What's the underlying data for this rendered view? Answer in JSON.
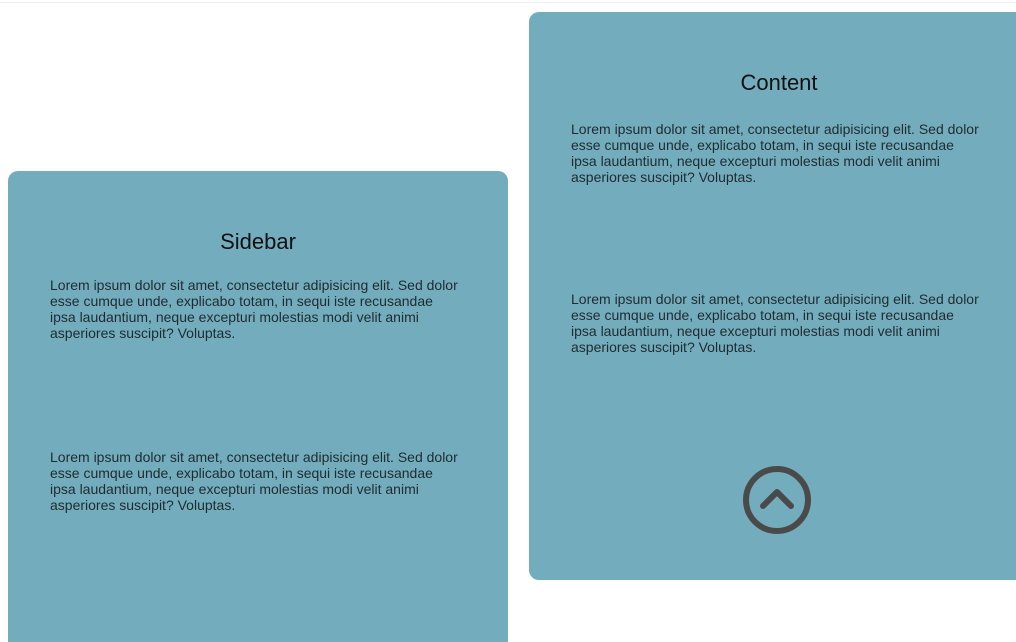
{
  "sidebar": {
    "title": "Sidebar",
    "paragraphs": [
      "Lorem ipsum dolor sit amet, consectetur adipisicing elit. Sed dolor esse cumque unde, explicabo totam, in sequi iste recusandae ipsa laudantium, neque excepturi molestias modi velit animi asperiores suscipit? Voluptas.",
      "Lorem ipsum dolor sit amet, consectetur adipisicing elit. Sed dolor esse cumque unde, explicabo totam, in sequi iste recusandae ipsa laudantium, neque excepturi molestias modi velit animi asperiores suscipit? Voluptas."
    ]
  },
  "content": {
    "title": "Content",
    "paragraphs": [
      "Lorem ipsum dolor sit amet, consectetur adipisicing elit. Sed dolor esse cumque unde, explicabo totam, in sequi iste recusandae ipsa laudantium, neque excepturi molestias modi velit animi asperiores suscipit? Voluptas.",
      "Lorem ipsum dolor sit amet, consectetur adipisicing elit. Sed dolor esse cumque unde, explicabo totam, in sequi iste recusandae ipsa laudantium, neque excepturi molestias modi velit animi asperiores suscipit? Voluptas."
    ],
    "scroll_icon": "chevron-up-circle-icon"
  },
  "colors": {
    "panel_background": "#73adbd",
    "icon": "#4a4a4a"
  }
}
